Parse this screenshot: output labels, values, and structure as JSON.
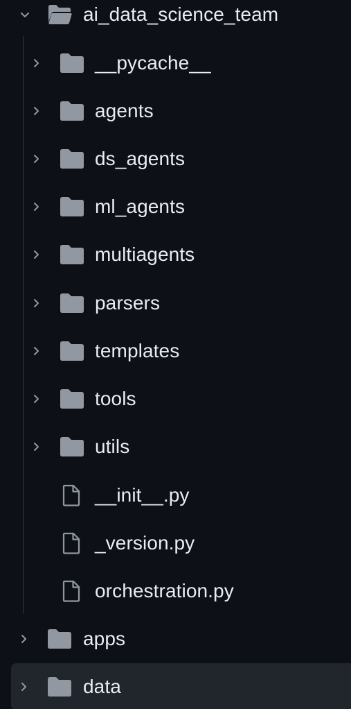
{
  "tree": {
    "root": {
      "label": "ai_data_science_team",
      "expanded": true,
      "children": [
        {
          "label": "__pycache__",
          "kind": "folder",
          "expanded": false
        },
        {
          "label": "agents",
          "kind": "folder",
          "expanded": false
        },
        {
          "label": "ds_agents",
          "kind": "folder",
          "expanded": false
        },
        {
          "label": "ml_agents",
          "kind": "folder",
          "expanded": false
        },
        {
          "label": "multiagents",
          "kind": "folder",
          "expanded": false
        },
        {
          "label": "parsers",
          "kind": "folder",
          "expanded": false
        },
        {
          "label": "templates",
          "kind": "folder",
          "expanded": false
        },
        {
          "label": "tools",
          "kind": "folder",
          "expanded": false
        },
        {
          "label": "utils",
          "kind": "folder",
          "expanded": false
        },
        {
          "label": "__init__.py",
          "kind": "file"
        },
        {
          "label": "_version.py",
          "kind": "file"
        },
        {
          "label": "orchestration.py",
          "kind": "file"
        }
      ]
    },
    "siblings": [
      {
        "label": "apps",
        "kind": "folder",
        "expanded": false,
        "selected": false
      },
      {
        "label": "data",
        "kind": "folder",
        "expanded": false,
        "selected": true
      }
    ]
  },
  "icons": {
    "expanded_chevron": "chevron-down-icon",
    "collapsed_chevron": "chevron-right-icon",
    "open_folder": "folder-open-icon",
    "closed_folder": "folder-icon",
    "file": "file-icon"
  },
  "colors": {
    "background": "#0d1117",
    "text": "#e6edf3",
    "icon": "#9198a1",
    "selected_row": "#21262d",
    "guide": "#30363d"
  }
}
